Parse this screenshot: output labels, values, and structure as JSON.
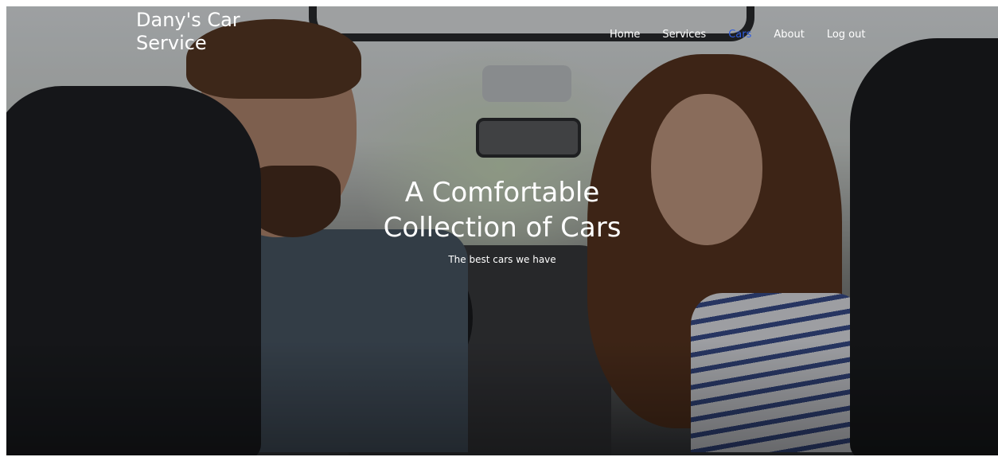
{
  "header": {
    "brand_line1": "Dany's Car",
    "brand_line2": "Service"
  },
  "nav": {
    "items": [
      {
        "label": "Home",
        "active": false
      },
      {
        "label": "Services",
        "active": false
      },
      {
        "label": "Cars",
        "active": true
      },
      {
        "label": "About",
        "active": false
      },
      {
        "label": "Log out",
        "active": false
      }
    ],
    "active_color": "#2f5de0"
  },
  "hero": {
    "title_line1": "A Comfortable",
    "title_line2": "Collection of Cars",
    "subtitle": "The best cars we have"
  }
}
